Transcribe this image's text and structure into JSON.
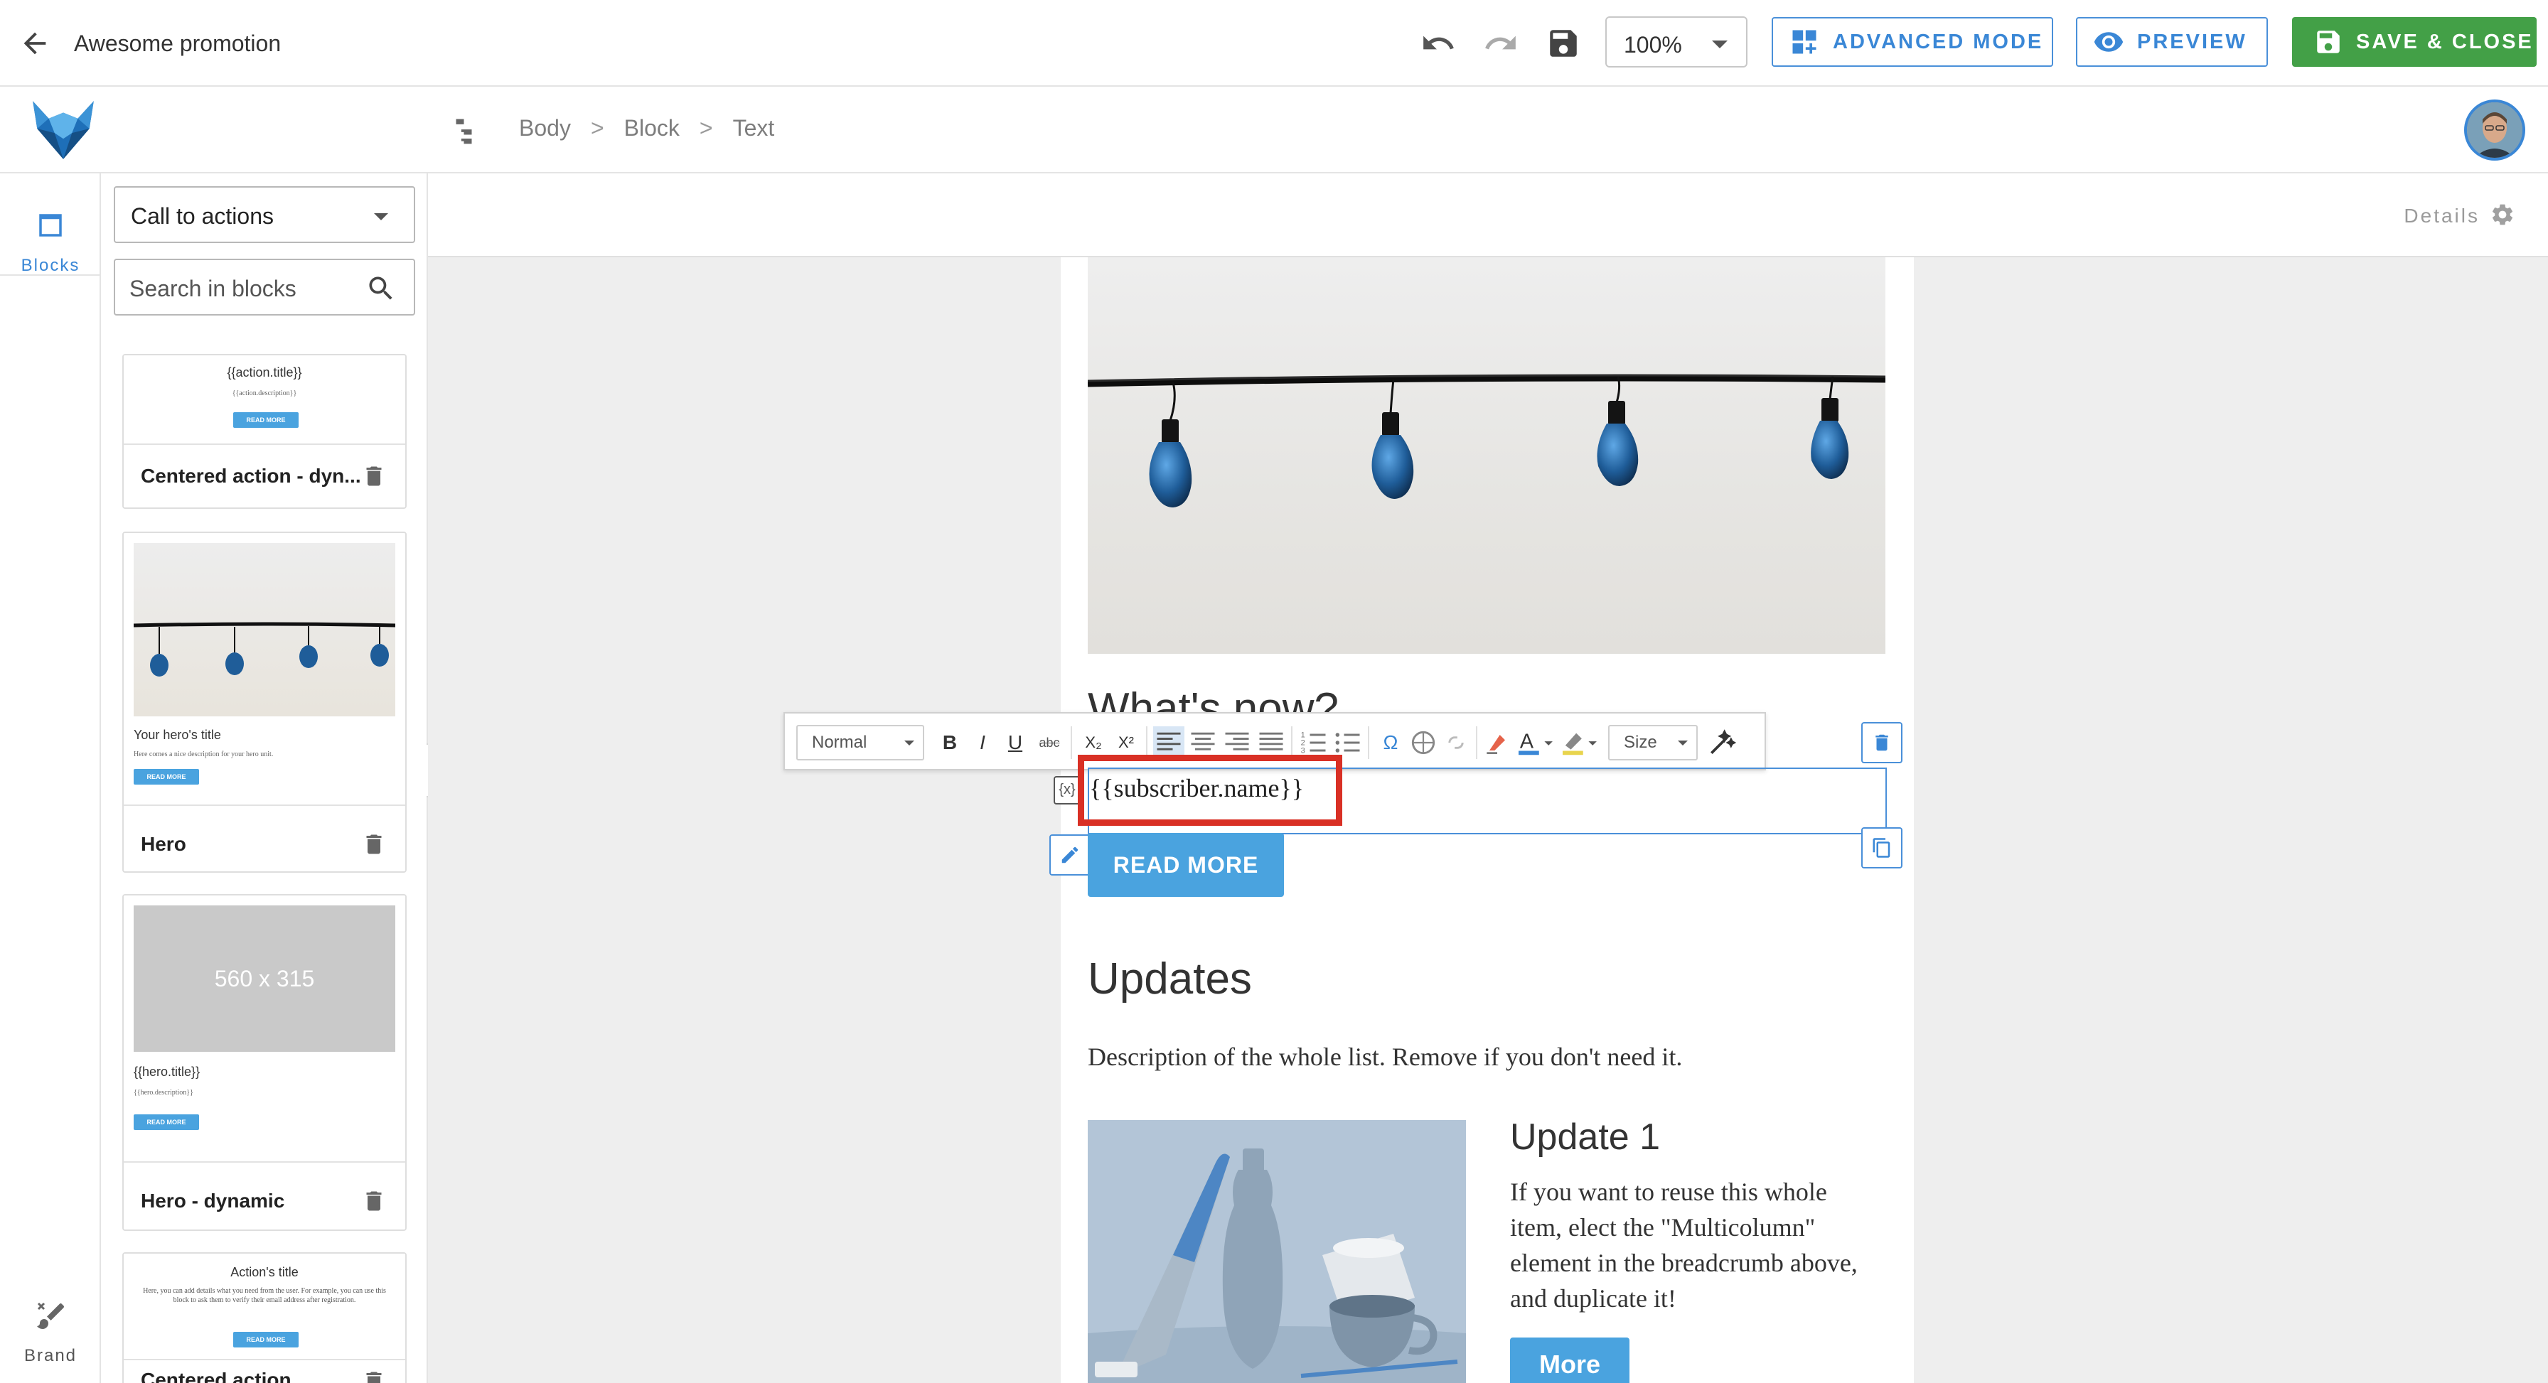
{
  "topbar": {
    "title": "Awesome promotion",
    "zoom": "100%",
    "advanced_mode_label": "ADVANCED MODE",
    "preview_label": "PREVIEW",
    "save_close_label": "SAVE & CLOSE"
  },
  "breadcrumb": [
    "Body",
    "Block",
    "Text"
  ],
  "leftnav": {
    "blocks_label": "Blocks",
    "brand_label": "Brand"
  },
  "blockpanel": {
    "category": "Call to actions",
    "search_placeholder": "Search in blocks",
    "cards": [
      {
        "name": "Centered action - dyn...",
        "preview_title": "{{action.title}}",
        "preview_desc": "{{action.description}}",
        "preview_btn": "READ MORE"
      },
      {
        "name": "Hero",
        "preview_title": "Your hero's title",
        "preview_desc": "Here comes a nice description for your hero unit.",
        "preview_btn": "READ MORE"
      },
      {
        "name": "Hero - dynamic",
        "preview_placeholder": "560 x 315",
        "preview_title": "{{hero.title}}",
        "preview_desc": "{{hero.description}}",
        "preview_btn": "READ MORE"
      },
      {
        "name": "Centered action",
        "preview_title": "Action's title",
        "preview_desc": "Here, you can add details what you need from the user. For example, you can use this block to ask them to verify their email address after registration.",
        "preview_btn": "READ MORE"
      }
    ]
  },
  "details": {
    "label": "Details"
  },
  "email": {
    "section_heading": "What's now?",
    "editing_text": "{{subscriber.name}}",
    "var_icon": "{x}",
    "read_more": "READ MORE",
    "updates_heading": "Updates",
    "updates_description": "Description of the whole list. Remove if you don't need it.",
    "update_title": "Update 1",
    "update_text": "If you want to reuse this whole item, elect the \"Multicolumn\" element in the breadcrumb above, and duplicate it!",
    "more_label": "More"
  },
  "rte_toolbar": {
    "format": "Normal",
    "size": "Size",
    "buttons": {
      "bold": "B",
      "italic": "I",
      "underline": "U",
      "strike": "abc",
      "subscript": "X₂",
      "superscript": "X²",
      "special_char": "Ω"
    }
  },
  "colors": {
    "accent": "#3a87d6",
    "button_blue": "#4aa3df",
    "save_green": "#43a047",
    "highlight_red": "#d93025"
  },
  "icons": {
    "back": "arrow-left-icon",
    "undo": "undo-icon",
    "redo": "redo-icon",
    "save": "floppy-icon",
    "advanced": "layout-icon",
    "preview": "eye-icon",
    "tree": "tree-icon",
    "blocks": "square-icon",
    "brand": "brush-icon",
    "search": "search-icon",
    "delete": "trash-icon",
    "settings": "gear-icon",
    "edit": "pencil-icon",
    "copy": "copy-icon"
  }
}
